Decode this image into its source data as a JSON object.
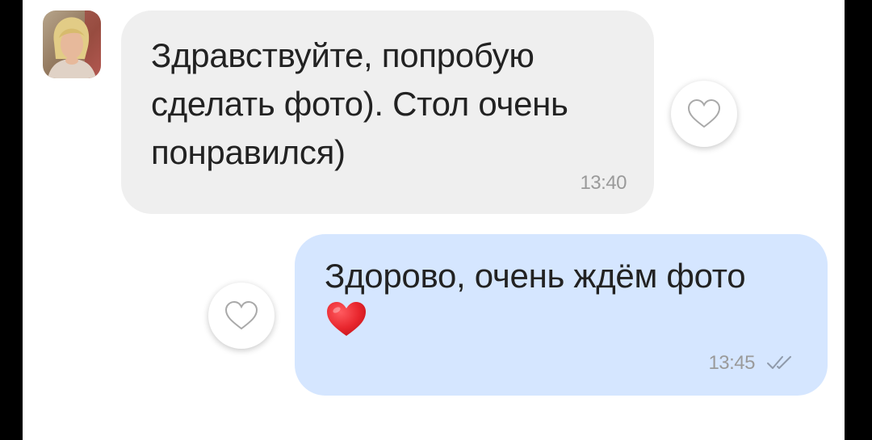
{
  "colors": {
    "incoming_bubble": "#efefef",
    "outgoing_bubble": "#d5e6ff",
    "heart_red": "#e8262d",
    "timestamp": "#9a9a9a",
    "text": "#222222"
  },
  "messages": [
    {
      "direction": "incoming",
      "text": "Здравствуйте, попробую\nсделать фото). Стол очень\nпонравился)",
      "time": "13:40",
      "liked": false
    },
    {
      "direction": "outgoing",
      "text": "Здорово, очень ждём фото",
      "emoji": "red-heart",
      "time": "13:45",
      "status_icon": "double-check-icon",
      "liked": false
    }
  ]
}
